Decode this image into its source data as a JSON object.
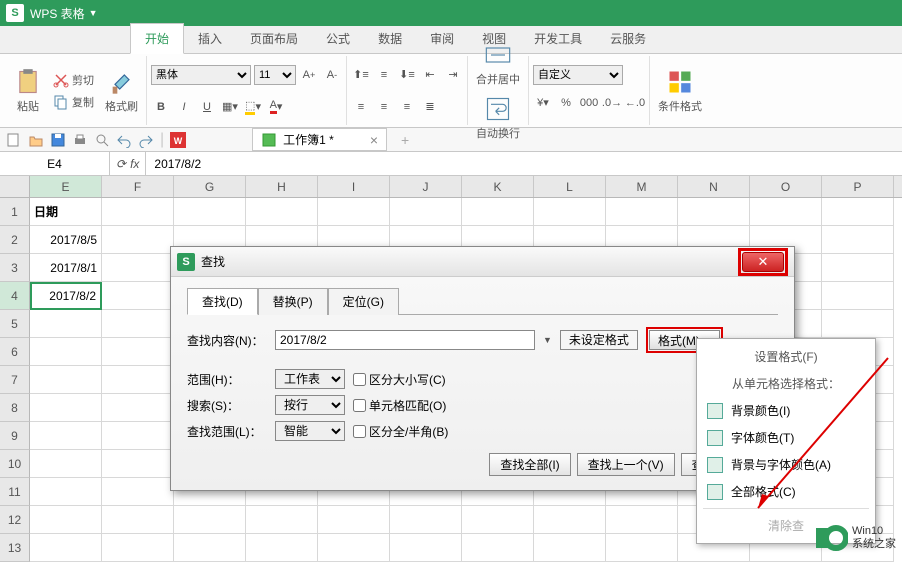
{
  "titlebar": {
    "app": "WPS 表格"
  },
  "ribbon_tabs": [
    "开始",
    "插入",
    "页面布局",
    "公式",
    "数据",
    "审阅",
    "视图",
    "开发工具",
    "云服务"
  ],
  "ribbon": {
    "paste": "粘贴",
    "cut": "剪切",
    "copy": "复制",
    "format_painter": "格式刷",
    "font_name": "黑体",
    "font_size": "11",
    "merge": "合并居中",
    "wrap": "自动换行",
    "number_format": "自定义",
    "cond_format": "条件格式"
  },
  "doc_tab": {
    "label": "工作簿1 *"
  },
  "formula_bar": {
    "cell_ref": "E4",
    "value": "2017/8/2"
  },
  "columns": [
    "E",
    "F",
    "G",
    "H",
    "I",
    "J",
    "K",
    "L",
    "M",
    "N",
    "O",
    "P"
  ],
  "rows": [
    1,
    2,
    3,
    4,
    5,
    6,
    7,
    8,
    9,
    10,
    11,
    12,
    13
  ],
  "data": {
    "E1": "日期",
    "E2": "2017/8/5",
    "E3": "2017/8/1",
    "E4": "2017/8/2"
  },
  "active_cell": "E4",
  "dialog": {
    "title": "查找",
    "tabs": {
      "find": "查找(D)",
      "replace": "替换(P)",
      "goto": "定位(G)"
    },
    "find_label": "查找内容(N)：",
    "find_value": "2017/8/2",
    "no_format": "未设定格式",
    "format_btn": "格式(M)",
    "scope_label": "范围(H)：",
    "scope_value": "工作表",
    "search_label": "搜索(S)：",
    "search_value": "按行",
    "lookin_label": "查找范围(L)：",
    "lookin_value": "智能",
    "chk_case": "区分大小写(C)",
    "chk_whole": "单元格匹配(O)",
    "chk_width": "区分全/半角(B)",
    "btn_all": "查找全部(I)",
    "btn_prev": "查找上一个(V)",
    "btn_next": "查找下一个(F)"
  },
  "fmt_menu": {
    "set": "设置格式(F)",
    "from_cell": "从单元格选择格式：",
    "bg": "背景颜色(I)",
    "font": "字体颜色(T)",
    "bgfont": "背景与字体颜色(A)",
    "all": "全部格式(C)",
    "clear": "清除查"
  },
  "watermark": {
    "line1": "Win10",
    "line2": "系统之家"
  },
  "chart_data": null
}
